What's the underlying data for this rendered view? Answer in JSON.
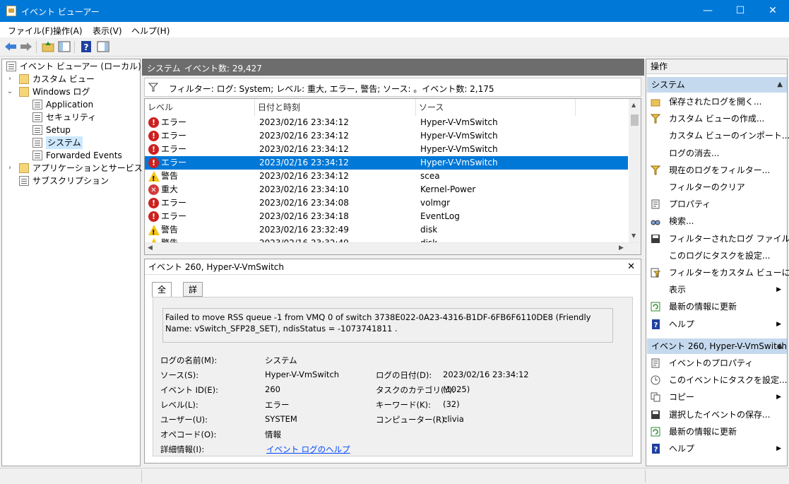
{
  "window": {
    "title": "イベント ビューアー",
    "minimize": "—",
    "maximize": "☐",
    "close": "✕"
  },
  "menu": [
    "ファイル(F)",
    "操作(A)",
    "表示(V)",
    "ヘルプ(H)"
  ],
  "tree": [
    {
      "label": "イベント ビューアー (ローカル)",
      "icon": "event-viewer-icon"
    },
    {
      "label": "カスタム ビュー",
      "icon": "folder-icon"
    },
    {
      "label": "Windows ログ",
      "icon": "folder-icon"
    },
    {
      "label": "Application",
      "icon": "log-icon"
    },
    {
      "label": "セキュリティ",
      "icon": "log-icon"
    },
    {
      "label": "Setup",
      "icon": "log-icon"
    },
    {
      "label": "システム",
      "icon": "log-icon"
    },
    {
      "label": "Forwarded Events",
      "icon": "log-icon"
    },
    {
      "label": "アプリケーションとサービス ログ",
      "icon": "folder-icon"
    },
    {
      "label": "サブスクリプション",
      "icon": "subscription-icon"
    }
  ],
  "log": {
    "name": "システム",
    "count": "イベント数: 29,427",
    "filter": "フィルター: ログ: System; レベル: 重大, エラー, 警告; ソース: 。イベント数: 2,175"
  },
  "grid": {
    "headers": [
      "レベル",
      "日付と時刻",
      "ソース"
    ],
    "rows": [
      {
        "level": "エラー",
        "type": "err",
        "time": "2023/02/16 23:34:12",
        "source": "Hyper-V-VmSwitch"
      },
      {
        "level": "エラー",
        "type": "err",
        "time": "2023/02/16 23:34:12",
        "source": "Hyper-V-VmSwitch"
      },
      {
        "level": "エラー",
        "type": "err",
        "time": "2023/02/16 23:34:12",
        "source": "Hyper-V-VmSwitch"
      },
      {
        "level": "エラー",
        "type": "err",
        "time": "2023/02/16 23:34:12",
        "source": "Hyper-V-VmSwitch"
      },
      {
        "level": "警告",
        "type": "warn",
        "time": "2023/02/16 23:34:12",
        "source": "scea"
      },
      {
        "level": "重大",
        "type": "crit",
        "time": "2023/02/16 23:34:10",
        "source": "Kernel-Power"
      },
      {
        "level": "エラー",
        "type": "err",
        "time": "2023/02/16 23:34:08",
        "source": "volmgr"
      },
      {
        "level": "エラー",
        "type": "err",
        "time": "2023/02/16 23:34:18",
        "source": "EventLog"
      },
      {
        "level": "警告",
        "type": "warn",
        "time": "2023/02/16 23:32:49",
        "source": "disk"
      },
      {
        "level": "警告",
        "type": "warn",
        "time": "2023/02/16 23:32:49",
        "source": "disk"
      }
    ],
    "selected_index": 3
  },
  "detail": {
    "title": "イベント 260, Hyper-V-VmSwitch",
    "tabs": [
      "全般",
      "詳細"
    ],
    "message": "Failed to move RSS queue -1 from VMQ 0 of switch 3738E022-0A23-4316-B1DF-6FB6F6110DE8 (Friendly Name: vSwitch_SFP28_SET), ndisStatus = -1073741811 .",
    "props": {
      "log_name_label": "ログの名前(M):",
      "log_name": "システム",
      "source_label": "ソース(S):",
      "source": "Hyper-V-VmSwitch",
      "logged_label": "ログの日付(D):",
      "logged": "2023/02/16 23:34:12",
      "event_id_label": "イベント ID(E):",
      "event_id": "260",
      "task_label": "タスクのカテゴリ(Y):",
      "task": "(1025)",
      "level_label": "レベル(L):",
      "level": "エラー",
      "keywords_label": "キーワード(K):",
      "keywords": "(32)",
      "user_label": "ユーザー(U):",
      "user": "SYSTEM",
      "computer_label": "コンピューター(R):",
      "computer": "clivia",
      "opcode_label": "オペコード(O):",
      "opcode": "情報",
      "more_label": "詳細情報(I):",
      "more_link": "イベント ログのヘルプ"
    }
  },
  "actions": {
    "header": "操作",
    "section1": "システム",
    "items1": [
      {
        "label": "保存されたログを開く...",
        "icon": "open-folder-icon"
      },
      {
        "label": "カスタム ビューの作成...",
        "icon": "filter-icon"
      },
      {
        "label": "カスタム ビューのインポート...",
        "icon": ""
      },
      {
        "label": "ログの消去...",
        "icon": ""
      },
      {
        "label": "現在のログをフィルター...",
        "icon": "filter-icon"
      },
      {
        "label": "フィルターのクリア",
        "icon": ""
      },
      {
        "label": "プロパティ",
        "icon": "properties-icon"
      },
      {
        "label": "検索...",
        "icon": "find-icon"
      },
      {
        "label": "フィルターされたログ ファイルの...",
        "icon": "save-icon"
      },
      {
        "label": "このログにタスクを設定...",
        "icon": ""
      },
      {
        "label": "フィルターをカスタム ビューに保...",
        "icon": "filter-save-icon"
      },
      {
        "label": "表示",
        "icon": "",
        "submenu": true
      },
      {
        "label": "最新の情報に更新",
        "icon": "refresh-icon"
      },
      {
        "label": "ヘルプ",
        "icon": "help-icon",
        "submenu": true
      }
    ],
    "section2": "イベント 260, Hyper-V-VmSwitch",
    "items2": [
      {
        "label": "イベントのプロパティ",
        "icon": "properties-icon"
      },
      {
        "label": "このイベントにタスクを設定...",
        "icon": "task-icon"
      },
      {
        "label": "コピー",
        "icon": "copy-icon",
        "submenu": true
      },
      {
        "label": "選択したイベントの保存...",
        "icon": "save-icon"
      },
      {
        "label": "最新の情報に更新",
        "icon": "refresh-icon"
      },
      {
        "label": "ヘルプ",
        "icon": "help-icon",
        "submenu": true
      }
    ]
  },
  "colors": {
    "titlebar": "#0078d7",
    "selection": "#0078d7",
    "section": "#c5d9ee"
  }
}
